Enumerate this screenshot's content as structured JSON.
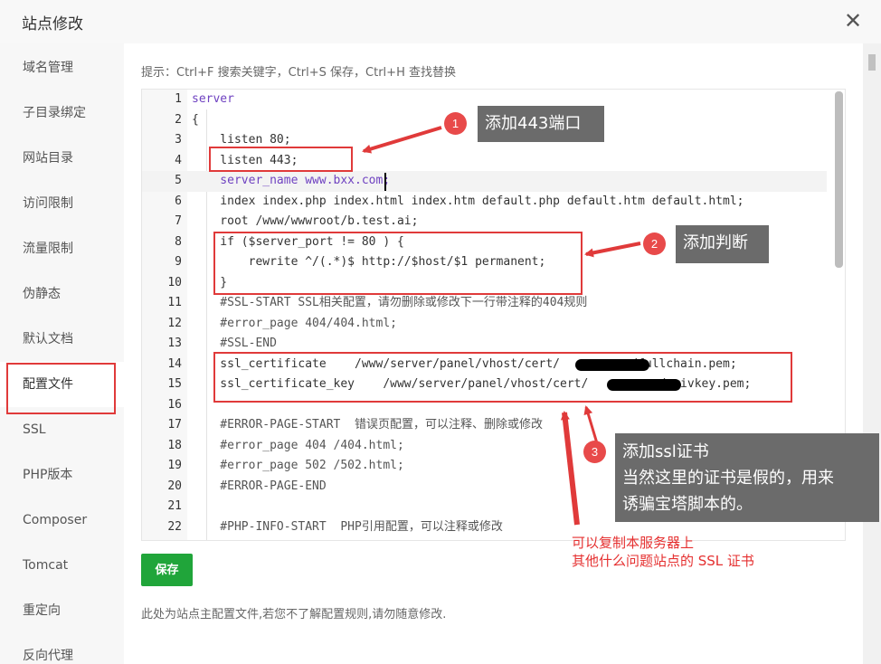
{
  "window": {
    "title": "站点修改"
  },
  "sidebar": {
    "items": [
      {
        "label": "域名管理"
      },
      {
        "label": "子目录绑定"
      },
      {
        "label": "网站目录"
      },
      {
        "label": "访问限制"
      },
      {
        "label": "流量限制"
      },
      {
        "label": "伪静态"
      },
      {
        "label": "默认文档"
      },
      {
        "label": "配置文件"
      },
      {
        "label": "SSL"
      },
      {
        "label": "PHP版本"
      },
      {
        "label": "Composer"
      },
      {
        "label": "Tomcat"
      },
      {
        "label": "重定向"
      },
      {
        "label": "反向代理"
      }
    ],
    "active": "配置文件"
  },
  "editor": {
    "hint": "提示：Ctrl+F 搜索关键字，Ctrl+S 保存，Ctrl+H 查找替换",
    "lines": [
      {
        "n": "1",
        "text": "server"
      },
      {
        "n": "2",
        "text": "{"
      },
      {
        "n": "3",
        "text": "    listen 80;"
      },
      {
        "n": "4",
        "text": "    listen 443;"
      },
      {
        "n": "5",
        "text": "    server_name www.bxx.com;"
      },
      {
        "n": "6",
        "text": "    index index.php index.html index.htm default.php default.htm default.html;"
      },
      {
        "n": "7",
        "text": "    root /www/wwwroot/b.test.ai;"
      },
      {
        "n": "8",
        "text": "    if ($server_port != 80 ) {"
      },
      {
        "n": "9",
        "text": "        rewrite ^/(.*)$ http://$host/$1 permanent;"
      },
      {
        "n": "10",
        "text": "    }"
      },
      {
        "n": "11",
        "text": "    #SSL-START SSL相关配置，请勿删除或修改下一行带注释的404规则"
      },
      {
        "n": "12",
        "text": "    #error_page 404/404.html;"
      },
      {
        "n": "13",
        "text": "    #SSL-END"
      },
      {
        "n": "14",
        "text": "    ssl_certificate    /www/server/panel/vhost/cert/          /fullchain.pem;"
      },
      {
        "n": "15",
        "text": "    ssl_certificate_key    /www/server/panel/vhost/cert/          /privkey.pem;"
      },
      {
        "n": "16",
        "text": ""
      },
      {
        "n": "17",
        "text": "    #ERROR-PAGE-START  错误页配置，可以注释、删除或修改"
      },
      {
        "n": "18",
        "text": "    #error_page 404 /404.html;"
      },
      {
        "n": "19",
        "text": "    #error_page 502 /502.html;"
      },
      {
        "n": "20",
        "text": "    #ERROR-PAGE-END"
      },
      {
        "n": "21",
        "text": ""
      },
      {
        "n": "22",
        "text": "    #PHP-INFO-START  PHP引用配置，可以注释或修改"
      }
    ]
  },
  "actions": {
    "save_label": "保存"
  },
  "footnote": "此处为站点主配置文件,若您不了解配置规则,请勿随意修改.",
  "annotations": {
    "a1": {
      "num": "1",
      "text": "添加443端口"
    },
    "a2": {
      "num": "2",
      "text": "添加判断"
    },
    "a3": {
      "num": "3",
      "lines": [
        "添加ssl证书",
        "当然这里的证书是假的，用来",
        "诱骗宝塔脚本的。"
      ]
    },
    "red_note": [
      "可以复制本服务器上",
      "其他什么问题站点的 SSL 证书"
    ]
  },
  "colors": {
    "accent": "#20a53a",
    "annotation": "#e03a3a",
    "callout_bg": "#6b6b6b"
  }
}
